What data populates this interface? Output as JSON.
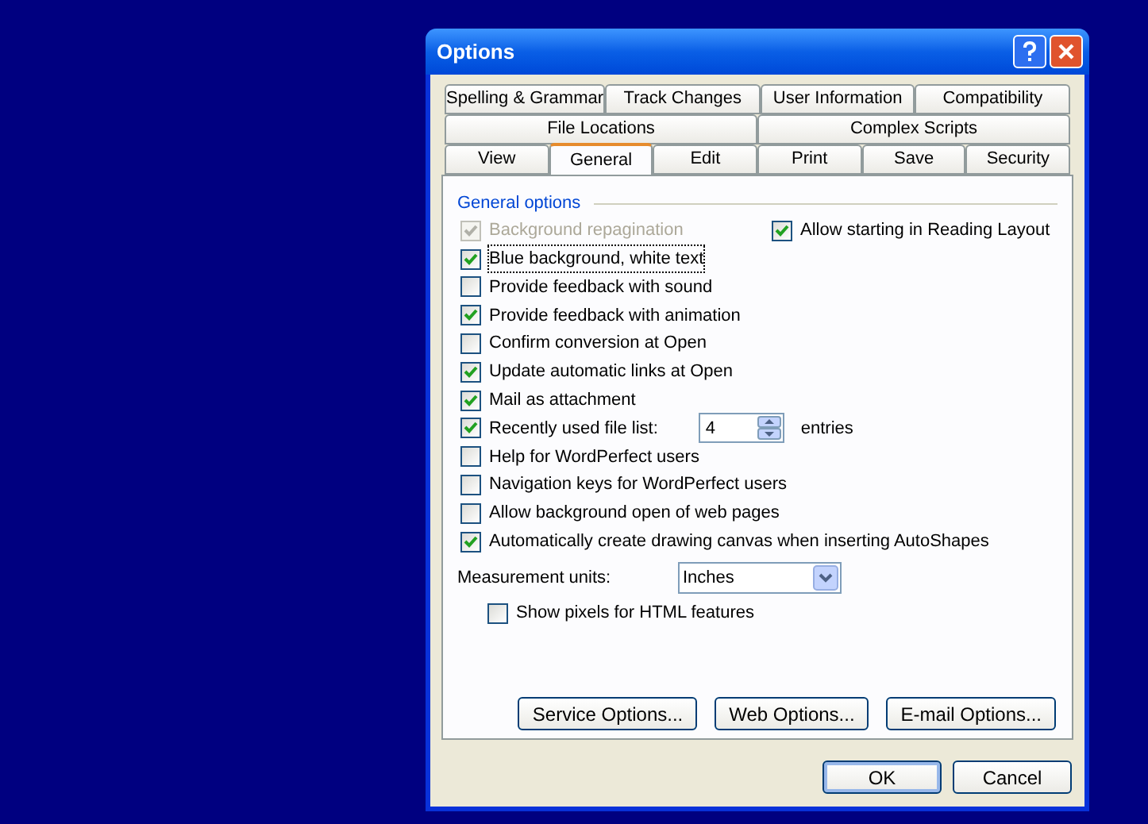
{
  "window": {
    "title": "Options"
  },
  "tab_rows": [
    [
      {
        "label": "Spelling & Grammar",
        "selected": false
      },
      {
        "label": "Track Changes",
        "selected": false
      },
      {
        "label": "User Information",
        "selected": false
      },
      {
        "label": "Compatibility",
        "selected": false
      }
    ],
    [
      {
        "label": "File Locations",
        "selected": false
      },
      {
        "label": "Complex Scripts",
        "selected": false
      }
    ],
    [
      {
        "label": "View",
        "selected": false
      },
      {
        "label": "General",
        "selected": true
      },
      {
        "label": "Edit",
        "selected": false
      },
      {
        "label": "Print",
        "selected": false
      },
      {
        "label": "Save",
        "selected": false
      },
      {
        "label": "Security",
        "selected": false
      }
    ]
  ],
  "group": {
    "title": "General options"
  },
  "options": [
    {
      "kind": "checkbox",
      "label": "Background repagination",
      "checked": true,
      "disabled": true
    },
    {
      "kind": "checkbox",
      "label": "Blue background, white text",
      "checked": true,
      "disabled": false,
      "focused": true
    },
    {
      "kind": "checkbox",
      "label": "Provide feedback with sound",
      "checked": false,
      "disabled": false
    },
    {
      "kind": "checkbox",
      "label": "Provide feedback with animation",
      "checked": true,
      "disabled": false
    },
    {
      "kind": "checkbox",
      "label": "Confirm conversion at Open",
      "checked": false,
      "disabled": false
    },
    {
      "kind": "checkbox",
      "label": "Update automatic links at Open",
      "checked": true,
      "disabled": false
    },
    {
      "kind": "checkbox",
      "label": "Mail as attachment",
      "checked": true,
      "disabled": false
    },
    {
      "kind": "spin",
      "label": "Recently used file list:",
      "checked": true,
      "disabled": false,
      "value": "4",
      "suffix": "entries"
    },
    {
      "kind": "checkbox",
      "label": "Help for WordPerfect users",
      "checked": false,
      "disabled": false
    },
    {
      "kind": "checkbox",
      "label": "Navigation keys for WordPerfect users",
      "checked": false,
      "disabled": false
    },
    {
      "kind": "checkbox",
      "label": "Allow background open of web pages",
      "checked": false,
      "disabled": false
    },
    {
      "kind": "checkbox",
      "label": "Automatically create drawing canvas when inserting AutoShapes",
      "checked": true,
      "disabled": false
    }
  ],
  "right_option": {
    "label": "Allow starting in Reading Layout",
    "checked": true
  },
  "measurement": {
    "label": "Measurement units:",
    "value": "Inches"
  },
  "pixels_option": {
    "label": "Show pixels for HTML features",
    "checked": false
  },
  "panel_buttons": [
    "Service Options...",
    "Web Options...",
    "E-mail Options..."
  ],
  "buttons": [
    {
      "label": "OK",
      "default": true
    },
    {
      "label": "Cancel",
      "default": false
    }
  ]
}
